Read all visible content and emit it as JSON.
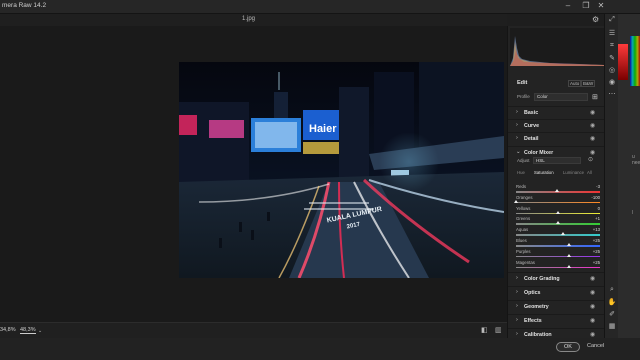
{
  "window": {
    "title": "mera Raw 14.2",
    "file_name": "1.jpg"
  },
  "toolbar": {
    "settings_icon": "gear-icon"
  },
  "bottom": {
    "zoom_field": "34,8%",
    "zoom_value": "48,3%"
  },
  "panel": {
    "edit_title": "Edit",
    "auto_label": "Auto",
    "bw_label": "B&W",
    "profile_label": "Profile",
    "profile_value": "Color",
    "sections_top": [
      {
        "name": "Basic"
      },
      {
        "name": "Curve"
      },
      {
        "name": "Detail"
      }
    ],
    "color_mixer": {
      "name": "Color Mixer",
      "adjust_label": "Adjust",
      "adjust_value": "HSL",
      "tabs": [
        "Hue",
        "Saturation",
        "Luminance",
        "All"
      ],
      "active_tab": 1,
      "sliders": [
        {
          "label": "Reds",
          "value": "-3",
          "position": 0.49,
          "gradient": "linear-gradient(90deg,#888,#e33)"
        },
        {
          "label": "Oranges",
          "value": "-100",
          "position": 0.0,
          "gradient": "linear-gradient(90deg,#888,#f82)"
        },
        {
          "label": "Yellows",
          "value": "0",
          "position": 0.5,
          "gradient": "linear-gradient(90deg,#888,#ee3)"
        },
        {
          "label": "Greens",
          "value": "+1",
          "position": 0.505,
          "gradient": "linear-gradient(90deg,#888,#3c3)"
        },
        {
          "label": "Aquas",
          "value": "+13",
          "position": 0.565,
          "gradient": "linear-gradient(90deg,#888,#3cc)"
        },
        {
          "label": "Blues",
          "value": "+25",
          "position": 0.625,
          "gradient": "linear-gradient(90deg,#888,#36f)"
        },
        {
          "label": "Purples",
          "value": "+25",
          "position": 0.625,
          "gradient": "linear-gradient(90deg,#888,#93e)"
        },
        {
          "label": "Magentas",
          "value": "+25",
          "position": 0.625,
          "gradient": "linear-gradient(90deg,#888,#e3c)"
        }
      ]
    },
    "sections_bottom": [
      {
        "name": "Color Grading"
      },
      {
        "name": "Optics"
      },
      {
        "name": "Geometry"
      },
      {
        "name": "Effects"
      },
      {
        "name": "Calibration"
      }
    ]
  },
  "footer": {
    "ok_label": "OK",
    "cancel_label": "Cancel"
  },
  "photo": {
    "sign_text": "Haier",
    "ground_text": "KUALA LUMPUR",
    "ground_year": "2017"
  },
  "background_app": {
    "text_1": "u need",
    "text_2": "l"
  }
}
